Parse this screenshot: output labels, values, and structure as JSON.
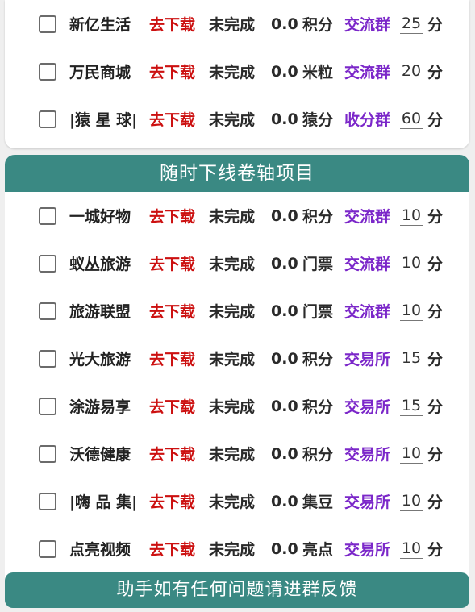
{
  "top_rows": [
    {
      "name": "新亿生活",
      "download": "去下载",
      "status": "未完成",
      "amount": "0.0",
      "unit": "积分",
      "group": "交流群",
      "value": "25",
      "suffix": "分"
    },
    {
      "name": "万民商城",
      "download": "去下载",
      "status": "未完成",
      "amount": "0.0",
      "unit": "米粒",
      "group": "交流群",
      "value": "20",
      "suffix": "分"
    },
    {
      "name": "|猿 星 球|",
      "download": "去下载",
      "status": "未完成",
      "amount": "0.0",
      "unit": "猿分",
      "group": "收分群",
      "value": "60",
      "suffix": "分"
    }
  ],
  "section_banner": "随时下线卷轴项目",
  "scroll_rows": [
    {
      "name": "一城好物",
      "download": "去下载",
      "status": "未完成",
      "amount": "0.0",
      "unit": "积分",
      "group": "交流群",
      "value": "10",
      "suffix": "分"
    },
    {
      "name": "蚁丛旅游",
      "download": "去下载",
      "status": "未完成",
      "amount": "0.0",
      "unit": "门票",
      "group": "交流群",
      "value": "10",
      "suffix": "分"
    },
    {
      "name": "旅游联盟",
      "download": "去下载",
      "status": "未完成",
      "amount": "0.0",
      "unit": "门票",
      "group": "交流群",
      "value": "10",
      "suffix": "分"
    },
    {
      "name": "光大旅游",
      "download": "去下载",
      "status": "未完成",
      "amount": "0.0",
      "unit": "积分",
      "group": "交易所",
      "value": "15",
      "suffix": "分"
    },
    {
      "name": "涂游易享",
      "download": "去下载",
      "status": "未完成",
      "amount": "0.0",
      "unit": "积分",
      "group": "交易所",
      "value": "15",
      "suffix": "分"
    },
    {
      "name": "沃德健康",
      "download": "去下载",
      "status": "未完成",
      "amount": "0.0",
      "unit": "积分",
      "group": "交易所",
      "value": "10",
      "suffix": "分"
    },
    {
      "name": "|嗨 品 集|",
      "download": "去下载",
      "status": "未完成",
      "amount": "0.0",
      "unit": "集豆",
      "group": "交易所",
      "value": "10",
      "suffix": "分"
    },
    {
      "name": "点亮视频",
      "download": "去下载",
      "status": "未完成",
      "amount": "0.0",
      "unit": "亮点",
      "group": "交易所",
      "value": "10",
      "suffix": "分"
    }
  ],
  "footer_banner": "助手如有任何问题请进群反馈",
  "colors": {
    "banner_bg": "#3a8983",
    "download_red": "#cc1010",
    "group_purple": "#7b27c9"
  }
}
